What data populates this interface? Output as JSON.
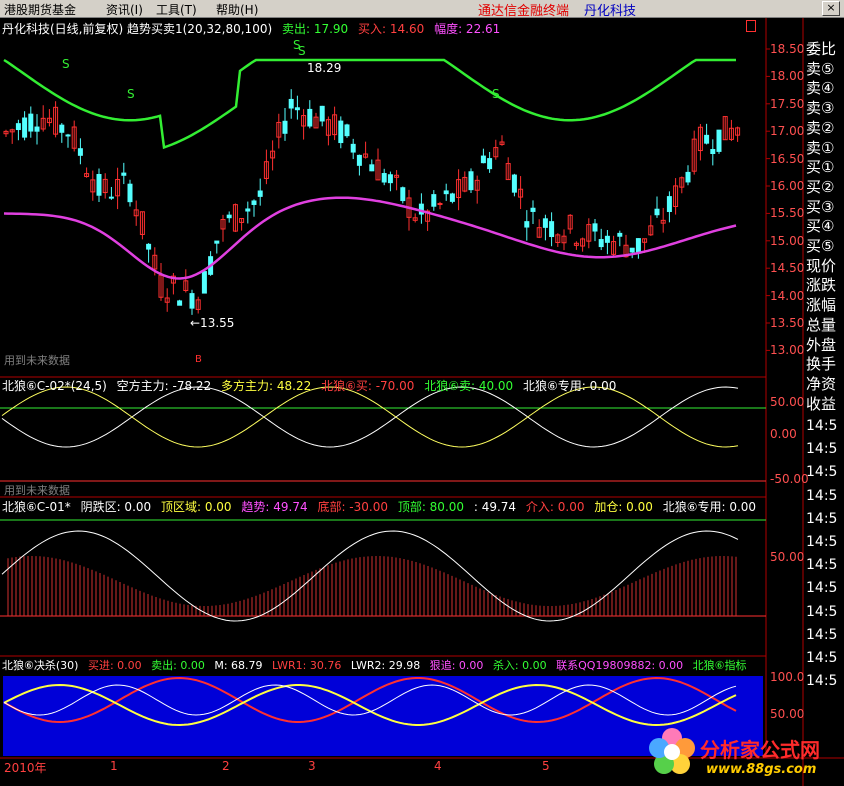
{
  "menu": {
    "items": [
      "港股期货基金",
      "资讯(I)",
      "工具(T)",
      "帮助(H)"
    ],
    "brand_red": "通达信金融终端",
    "brand_blue": "丹化科技",
    "close_glyph": "×"
  },
  "main": {
    "title": "丹化科技(日线,前复权) 趋势买卖1(20,32,80,100)",
    "sell_label": "卖出: 17.90",
    "buy_label": "买入: 14.60",
    "amp_label": "幅度: 22.61",
    "high_label": "18.29",
    "low_label": "←13.55",
    "future_label": "用到未来数据",
    "s_marks": [
      "S",
      "S",
      "S",
      "S",
      "S"
    ],
    "b_mark": "B",
    "price_ticks": [
      "18.50",
      "18.00",
      "17.50",
      "17.00",
      "16.50",
      "16.00",
      "15.50",
      "15.00",
      "14.50",
      "14.00",
      "13.50",
      "13.00"
    ]
  },
  "panel2": {
    "name": "北狼⑥C-02*(24,5)",
    "kong": "空方主力: -78.22",
    "duo": "多方主力: 48.22",
    "buy": "北狼⑥买: -70.00",
    "sell": "北狼⑥卖: 40.00",
    "special": "北狼⑥专用: 0.00",
    "ticks": [
      "50.00",
      "0.00",
      "-50.00"
    ],
    "future_label": "用到未来数据"
  },
  "panel3": {
    "name": "北狼⑥C-01*",
    "yindie": "阴跌区: 0.00",
    "dingqu": "顶区域: 0.00",
    "qushi": "趋势: 49.74",
    "dibu": "底部: -30.00",
    "dingbu": "顶部: 80.00",
    "val": ": 49.74",
    "jieru": "介入: 0.00",
    "jiacang": "加仓: 0.00",
    "special": "北狼⑥专用: 0.00",
    "ticks": [
      "50.00"
    ]
  },
  "panel4": {
    "name": "北狼⑥决杀(30)",
    "buyin": "买进: 0.00",
    "sellout": "卖出: 0.00",
    "m": "M: 68.79",
    "lwr1": "LWR1: 30.76",
    "lwr2": "LWR2: 29.98",
    "henzhui": "狠追: 0.00",
    "shaRu": "杀入: 0.00",
    "contact": "联系QQ19809882: 0.00",
    "indicator": "北狼⑥指标",
    "ticks": [
      "100.0",
      "50.00"
    ]
  },
  "timeline": {
    "labels": [
      "2010年",
      "1",
      "2",
      "3",
      "4",
      "5"
    ]
  },
  "right_panel": {
    "labels": [
      "委比",
      "卖⑤",
      "卖④",
      "卖③",
      "卖②",
      "卖①",
      "买①",
      "买②",
      "买③",
      "买④",
      "买⑤",
      "现价",
      "涨跌",
      "涨幅",
      "总量",
      "外盘",
      "换手",
      "净资",
      "收益"
    ],
    "repeat_label": "14:5",
    "repeat_count": 12
  },
  "watermark": {
    "title": "分析家公式网",
    "url": "www.88gs.com"
  },
  "colors": {
    "up": "#ff3030",
    "down": "#54ffff",
    "green_band": "#33ee33",
    "magenta_band": "#e040e0",
    "menu_bg": "#d4d0c8"
  }
}
